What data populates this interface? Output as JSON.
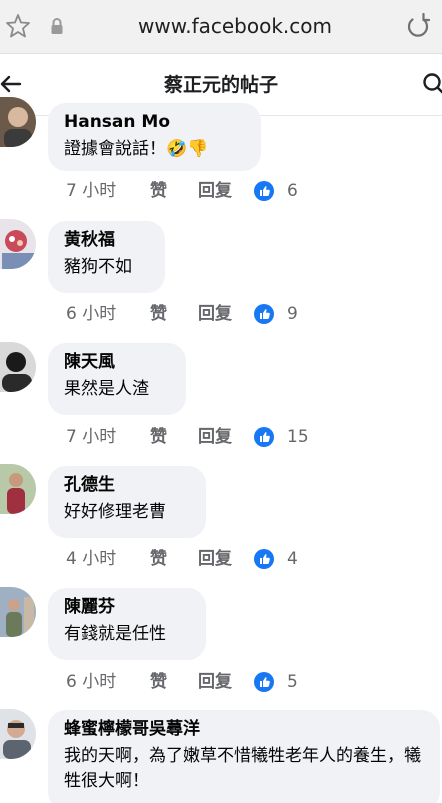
{
  "browser": {
    "url": "www.facebook.com",
    "icons": [
      "star-icon",
      "lock-icon",
      "reload-icon"
    ]
  },
  "header": {
    "title": "蔡正元的帖子",
    "icons": [
      "back-arrow-icon",
      "search-icon"
    ]
  },
  "labels": {
    "like": "赞",
    "reply": "回复"
  },
  "accent_color": "#1877f2",
  "comments": [
    {
      "name": "Hansan Mo",
      "text": "證據會說話！🤣👎",
      "time": "7 小时",
      "reactions": "6"
    },
    {
      "name": "黄秋福",
      "text": "豬狗不如",
      "time": "6 小时",
      "reactions": "9"
    },
    {
      "name": "陳天風",
      "text": "果然是人渣",
      "time": "7 小时",
      "reactions": "15"
    },
    {
      "name": "孔德生",
      "text": "好好修理老曹",
      "time": "4 小时",
      "reactions": "4"
    },
    {
      "name": "陳麗芬",
      "text": "有錢就是任性",
      "time": "6 小时",
      "reactions": "5"
    },
    {
      "name": "蜂蜜檸檬哥吳蕁洋",
      "text": "我的天啊，為了嫩草不惜犧牲老年人的養生，犧牲很大啊！"
    }
  ]
}
